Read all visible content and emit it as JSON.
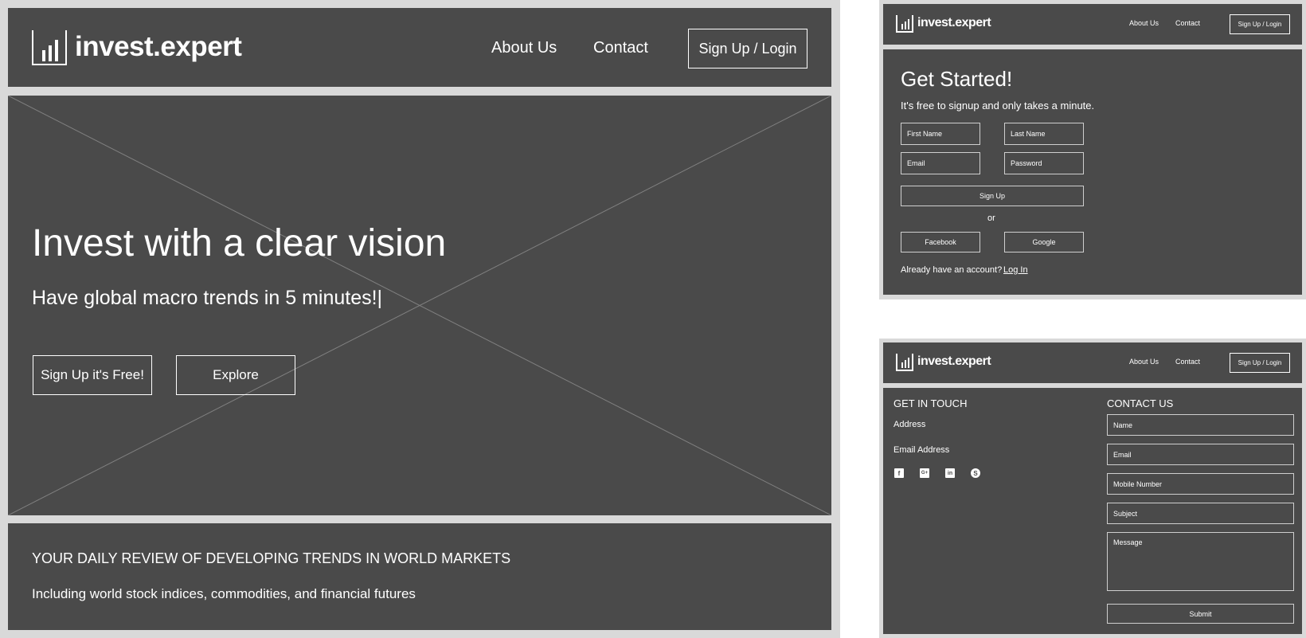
{
  "brand": {
    "name": "invest.expert"
  },
  "nav": {
    "about": "About Us",
    "contact": "Contact",
    "signup_login": "Sign Up / Login"
  },
  "hero": {
    "headline": "Invest with a clear vision",
    "subhead": "Have global macro trends in 5 minutes!|",
    "cta_signup": "Sign Up it's Free!",
    "cta_explore": "Explore"
  },
  "review": {
    "title": "YOUR DAILY REVIEW OF DEVELOPING TRENDS IN WORLD MARKETS",
    "subtitle": "Including world stock indices, commodities, and financial futures"
  },
  "signup": {
    "title": "Get Started!",
    "subtitle": "It's free to signup and only takes a minute.",
    "first_name": "First Name",
    "last_name": "Last Name",
    "email": "Email",
    "password": "Password",
    "submit": "Sign Up",
    "or": "or",
    "facebook": "Facebook",
    "google": "Google",
    "already": "Already have an account?",
    "login_link": "Log In"
  },
  "contact": {
    "get_in_touch": "GET IN TOUCH",
    "address": "Address",
    "email_address": "Email Address",
    "social_icons": [
      "facebook-icon",
      "google-plus-icon",
      "linkedin-icon",
      "skype-icon"
    ],
    "contact_us": "CONTACT US",
    "name": "Name",
    "email": "Email",
    "mobile": "Mobile Number",
    "subject": "Subject",
    "message": "Message",
    "submit": "Submit"
  },
  "colors": {
    "panel": "#4a4a4a",
    "frame": "#d9d9d9",
    "text": "#ffffff",
    "field_border": "#cfcfcf"
  }
}
